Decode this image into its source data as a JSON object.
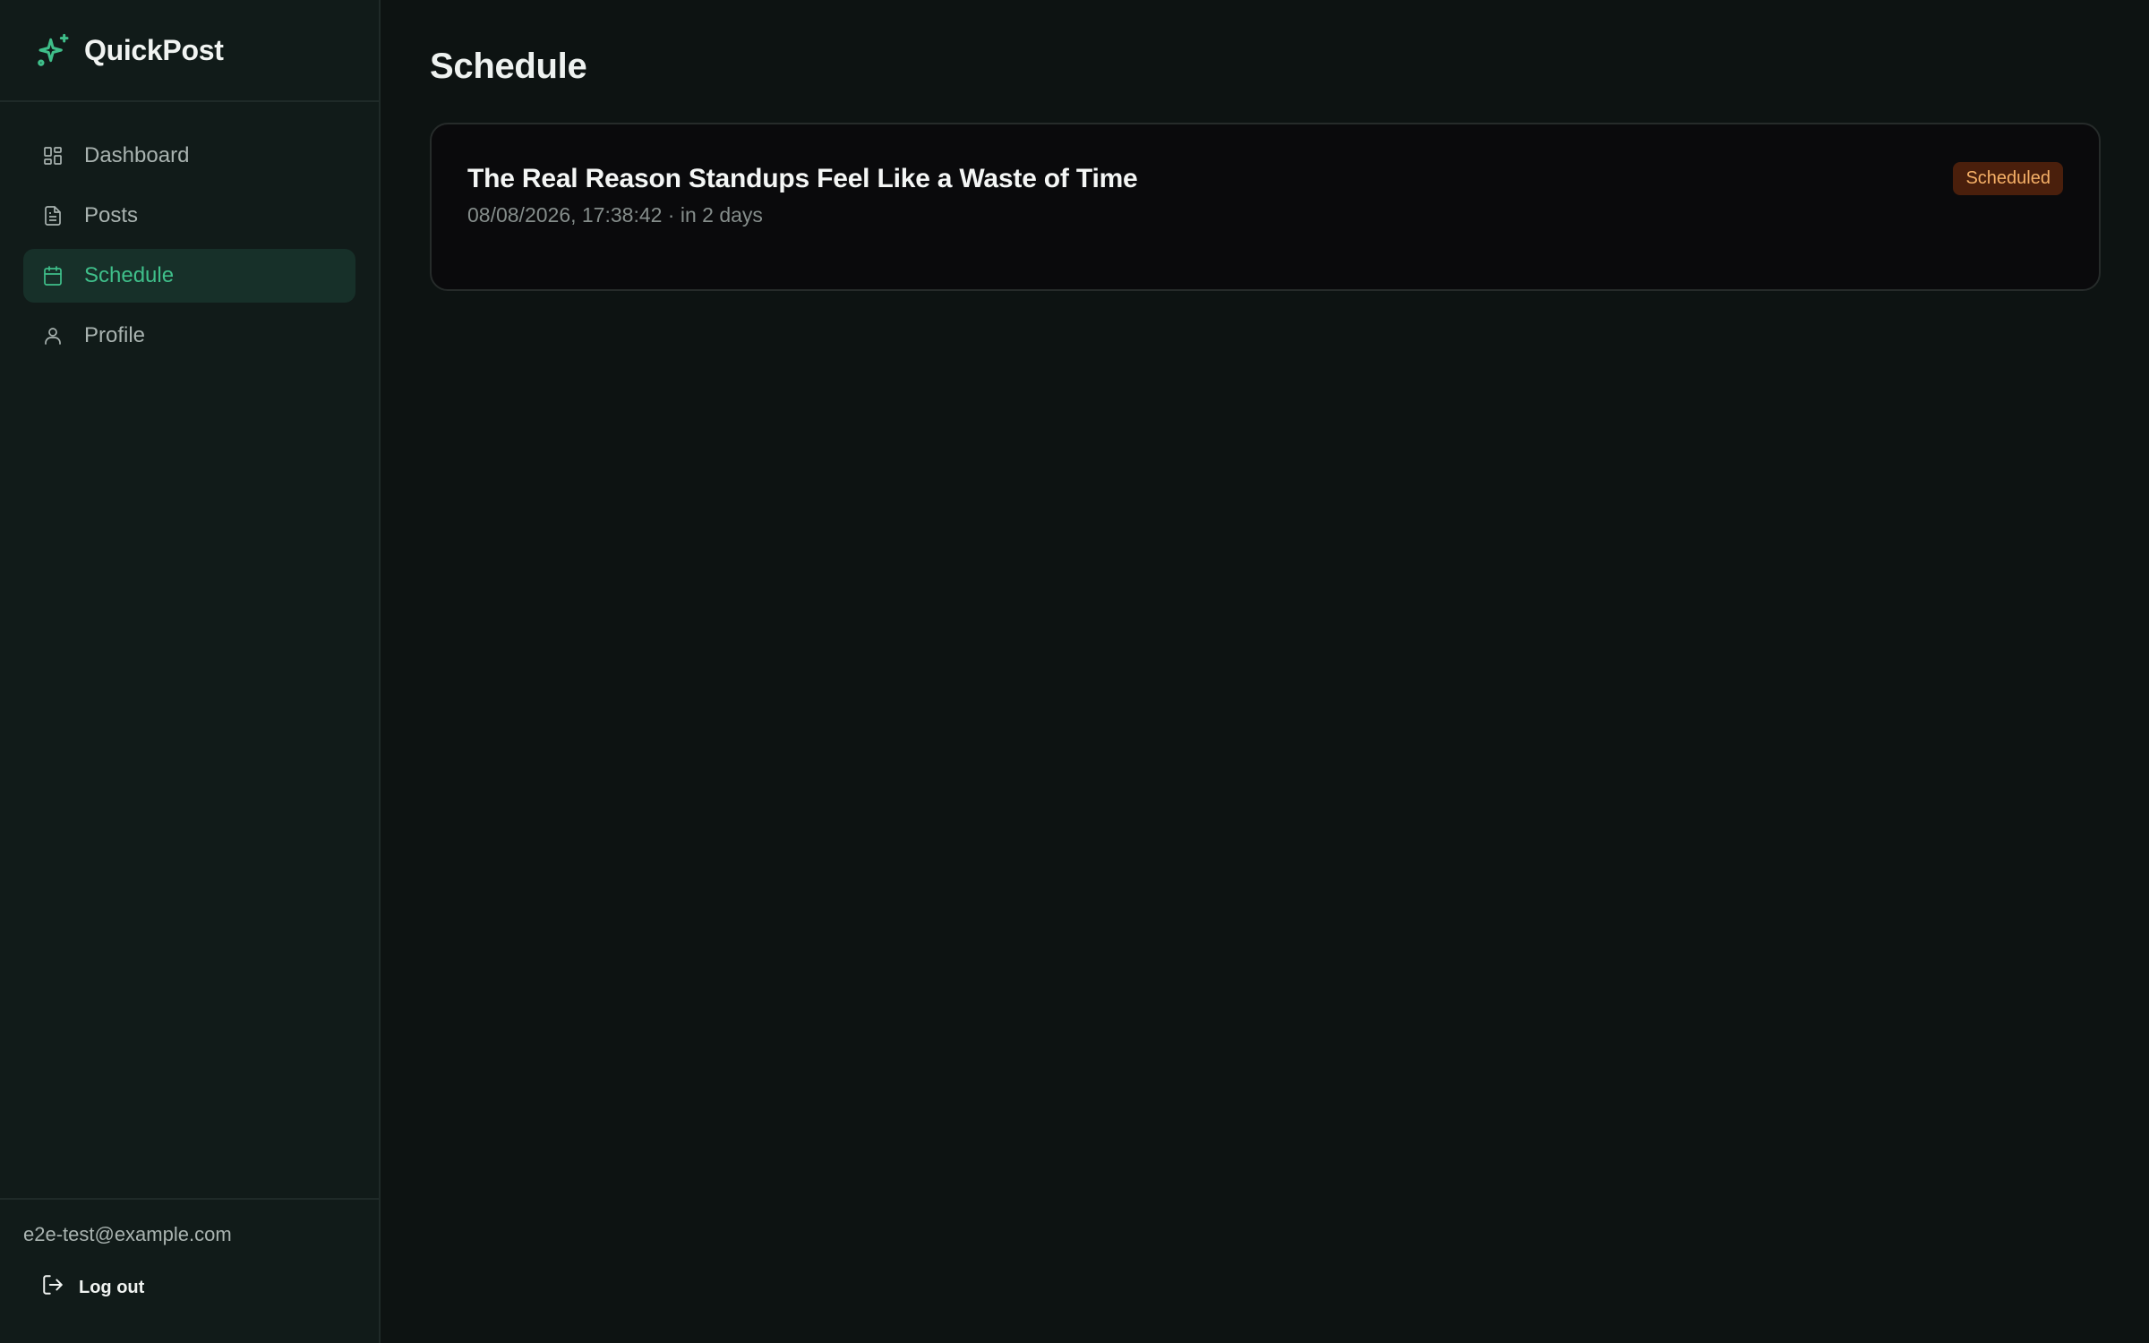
{
  "brand": {
    "name": "QuickPost",
    "icon": "sparkles-icon",
    "accent": "#3fbf8a"
  },
  "sidebar": {
    "items": [
      {
        "label": "Dashboard",
        "icon": "dashboard-icon",
        "active": false
      },
      {
        "label": "Posts",
        "icon": "document-icon",
        "active": false
      },
      {
        "label": "Schedule",
        "icon": "calendar-icon",
        "active": true
      },
      {
        "label": "Profile",
        "icon": "user-icon",
        "active": false
      }
    ],
    "user_email": "e2e-test@example.com",
    "logout_label": "Log out"
  },
  "main": {
    "title": "Schedule",
    "posts": [
      {
        "title": "The Real Reason Standups Feel Like a Waste of Time",
        "meta": "08/08/2026, 17:38:42 · in 2 days",
        "status": "Scheduled",
        "status_color": "#f6b067"
      }
    ]
  }
}
